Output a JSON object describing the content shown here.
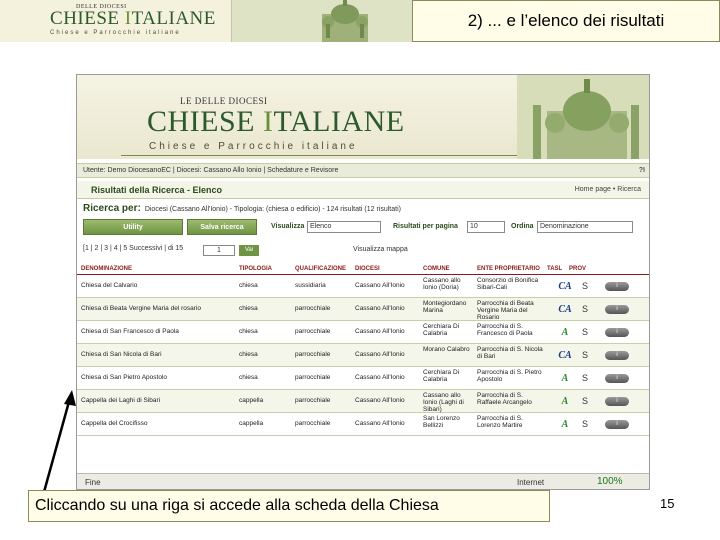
{
  "slide": {
    "title": "2) ... e l’elenco dei risultati",
    "caption": "Cliccando su una riga si accede alla scheda della Chiesa",
    "number": "15"
  },
  "logo": {
    "top": "DELLE DIOCESI",
    "big_first": "C",
    "big_mid": "HIESE ",
    "big_accent": "I",
    "big_last": "TALIANE",
    "sub": "Chiese e Parrocchie italiane"
  },
  "site": {
    "logo_small": "LE          DELLE DIOCESI",
    "logo_big_first": "C",
    "logo_big_mid": "HIESE ",
    "logo_big_accent": "I",
    "logo_big_last": "TALIANE",
    "logo_sub": "Chiese e Parrocchie italiane"
  },
  "userbar": {
    "text": "Utente: Demo DiocesanoEC  |  Diocesi: Cassano Allo Ionio  |  Schedature e Revisore",
    "help": "?I"
  },
  "panel": {
    "title": "Risultati della Ricerca - Elenco",
    "links": "Home page • Ricerca"
  },
  "ricerca": {
    "label": "Ricerca per:",
    "text": "Diocesi (Cassano All'Ionio) - Tipologia: (chiesa o edificio) - 124 risultati (12 risultati)"
  },
  "toolbar": {
    "utility": "Utility",
    "salva": "Salva ricerca",
    "visualizza_label": "Visualizza",
    "visualizza_value": "Elenco",
    "risultati_label": "Risultati per pagina",
    "risultati_value": "10",
    "ordina_label": "Ordina",
    "ordina_value": "Denominazione"
  },
  "pager": {
    "text": "[1 | 2 | 3 | 4 | 5  Successivi | di 15",
    "page_value": "1",
    "go": "Vai",
    "maps": "Visualizza mappa"
  },
  "table": {
    "columns": [
      "DENOMINAZIONE",
      "TIPOLOGIA",
      "QUALIFICAZIONE",
      "DIOCESI",
      "COMUNE",
      "ENTE PROPRIETARIO",
      "TASL",
      "PROV"
    ],
    "rows": [
      {
        "name": "Chiesa del Calvario",
        "tipo": "chiesa",
        "qual": "sussidiaria",
        "diocesi": "Cassano All'Ionio",
        "comune": "Cassano allo Ionio (Doria)",
        "ente": "Consorzio di Bonifica Sibari-Cali",
        "badge": "CA",
        "badge_color": "#1a3a8a"
      },
      {
        "name": "Chiesa di Beata Vergine Maria del rosario",
        "tipo": "chiesa",
        "qual": "parrocchiale",
        "diocesi": "Cassano All'Ionio",
        "comune": "Montegiordano Marina",
        "ente": "Parrocchia di Beata Vergine Maria del Rosario",
        "badge": "CA",
        "badge_color": "#1a3a8a"
      },
      {
        "name": "Chiesa di San Francesco di Paola",
        "tipo": "chiesa",
        "qual": "parrocchiale",
        "diocesi": "Cassano All'Ionio",
        "comune": "Cerchiara Di Calabria",
        "ente": "Parrocchia di S. Francesco di Paola",
        "badge": "A",
        "badge_color": "#2a8a2a"
      },
      {
        "name": "Chiesa di San Nicola di Bari",
        "tipo": "chiesa",
        "qual": "parrocchiale",
        "diocesi": "Cassano All'Ionio",
        "comune": "Morano Calabro",
        "ente": "Parrocchia di S. Nicola di Bari",
        "badge": "CA",
        "badge_color": "#1a3a8a"
      },
      {
        "name": "Chiesa di San Pietro Apostolo",
        "tipo": "chiesa",
        "qual": "parrocchiale",
        "diocesi": "Cassano All'Ionio",
        "comune": "Cerchiara Di Calabria",
        "ente": "Parrocchia di S. Pietro Apostolo",
        "badge": "A",
        "badge_color": "#2a8a2a"
      },
      {
        "name": "Cappella dei Laghi di Sibari",
        "tipo": "cappella",
        "qual": "parrocchiale",
        "diocesi": "Cassano All'Ionio",
        "comune": "Cassano allo Ionio (Laghi di Sibari)",
        "ente": "Parrocchia di S. Raffaele Arcangelo",
        "badge": "A",
        "badge_color": "#2a8a2a"
      },
      {
        "name": "Cappella del Crocifisso",
        "tipo": "cappella",
        "qual": "parrocchiale",
        "diocesi": "Cassano All'Ionio",
        "comune": "San Lorenzo Bellizzi",
        "ente": "Parrocchia di S. Lorenzo Martire",
        "badge": "A",
        "badge_color": "#2a8a2a"
      }
    ],
    "lock_icon": "S",
    "row_button": "i"
  },
  "status": {
    "left": "Fine",
    "mid": "Internet",
    "right": "100%"
  },
  "colors": {
    "accent_green": "#6f9444",
    "header_red": "#8a1a1a",
    "caption_bg": "#fffde7"
  }
}
